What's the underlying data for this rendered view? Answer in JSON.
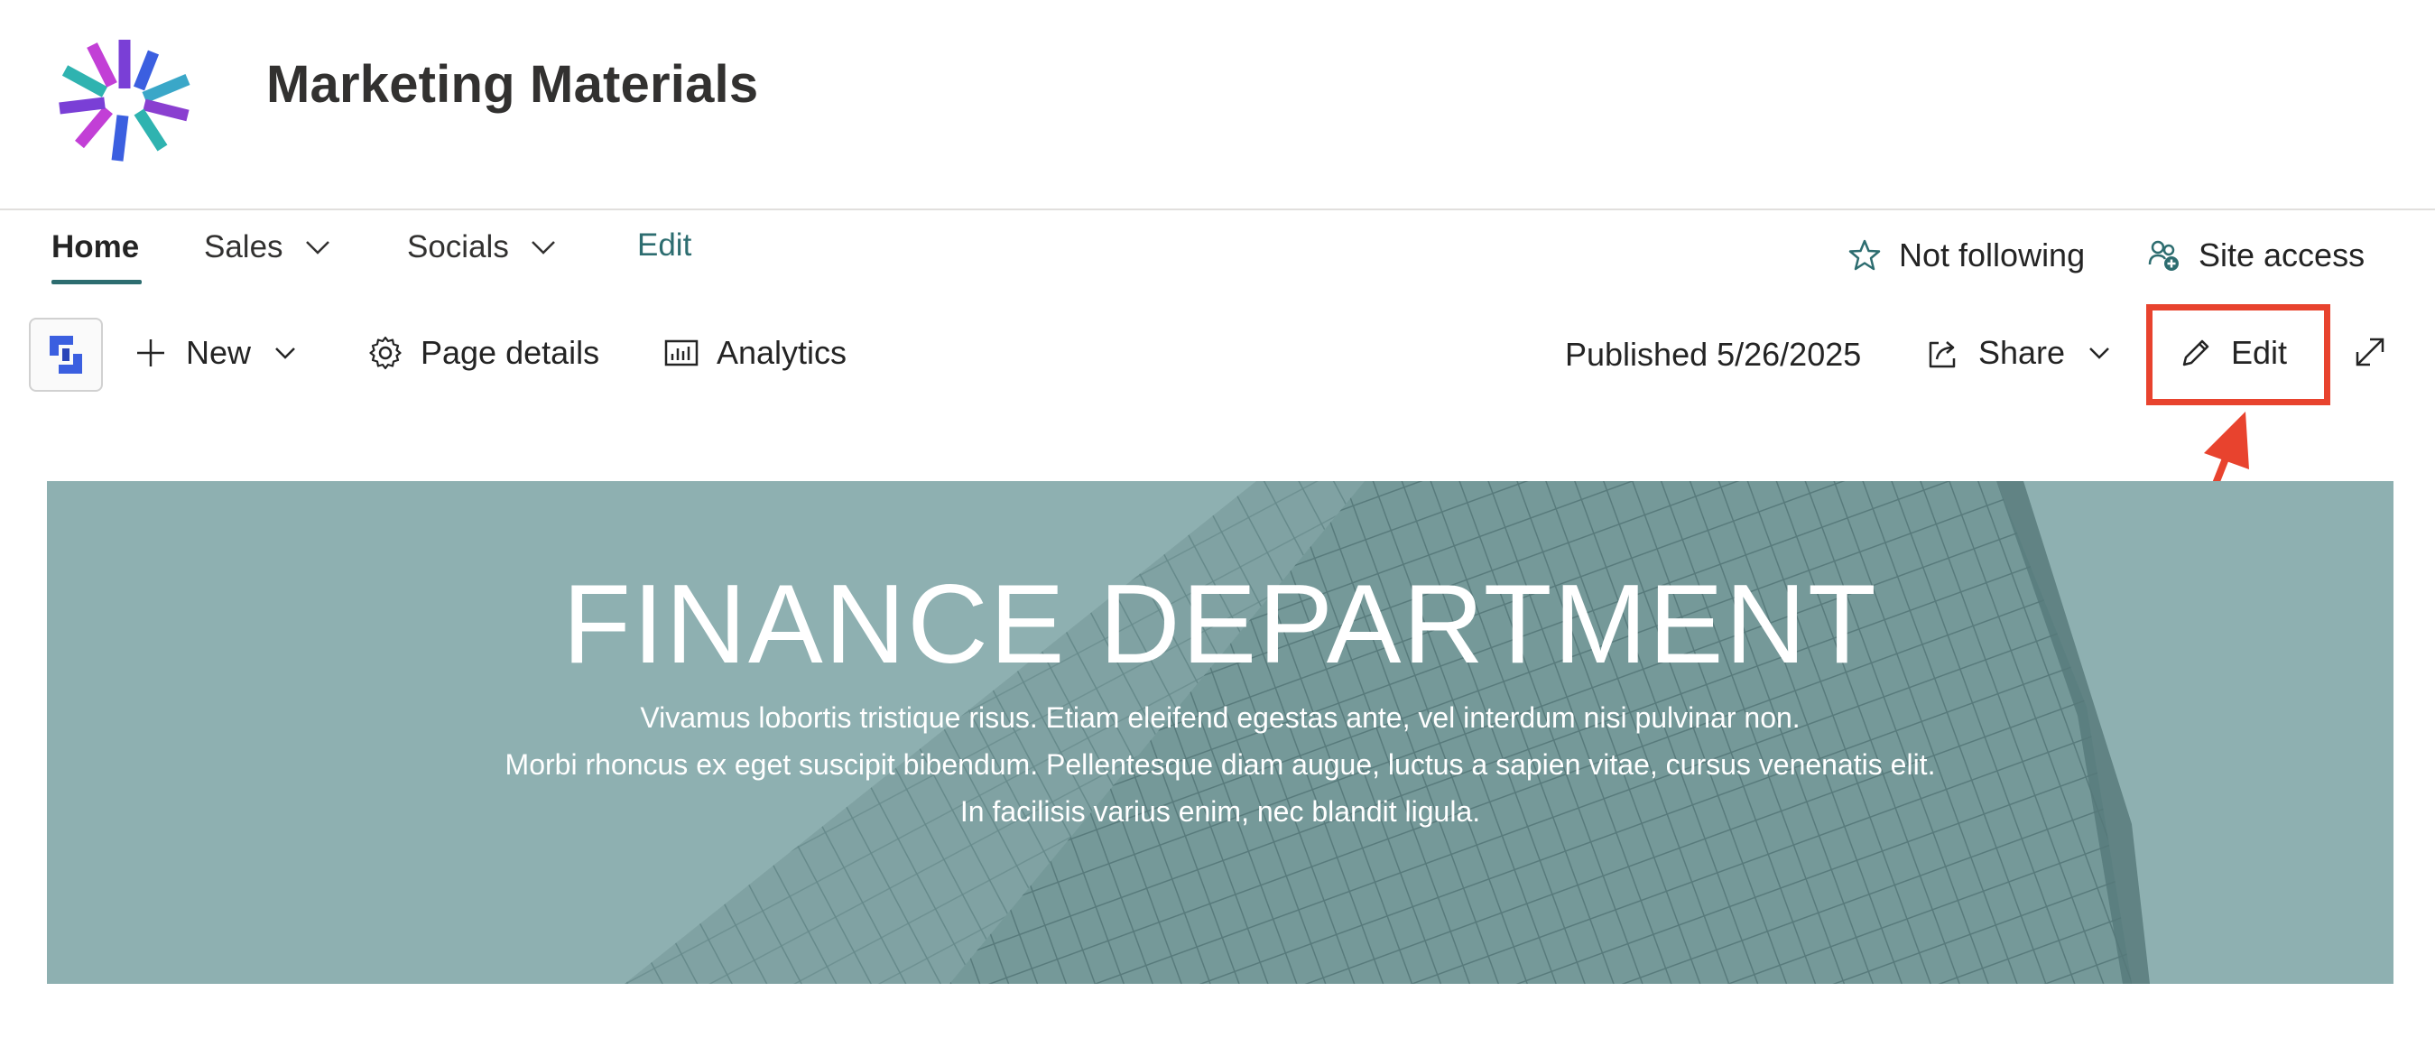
{
  "site": {
    "title": "Marketing Materials",
    "logo_icon": "site-logo-icon"
  },
  "nav": {
    "items": [
      {
        "label": "Home",
        "active": true
      },
      {
        "label": "Sales",
        "has_dropdown": true
      },
      {
        "label": "Socials",
        "has_dropdown": true
      }
    ],
    "edit_label": "Edit"
  },
  "header_actions": {
    "follow_label": "Not following",
    "site_access_label": "Site access"
  },
  "command_bar": {
    "new_label": "New",
    "page_details_label": "Page details",
    "analytics_label": "Analytics",
    "published_text": "Published 5/26/2025",
    "share_label": "Share",
    "edit_label": "Edit"
  },
  "hero": {
    "title": "FINANCE DEPARTMENT",
    "lines": [
      "Vivamus lobortis tristique risus. Etiam eleifend egestas ante, vel interdum nisi pulvinar non.",
      "Morbi rhoncus ex eget suscipit bibendum. Pellentesque diam augue, luctus a sapien vitae, cursus venenatis elit.",
      "In facilisis varius enim, nec blandit ligula."
    ]
  },
  "colors": {
    "accent": "#2d6d70",
    "annotation": "#e8432e",
    "hero_tint": "#8fb0b1"
  }
}
